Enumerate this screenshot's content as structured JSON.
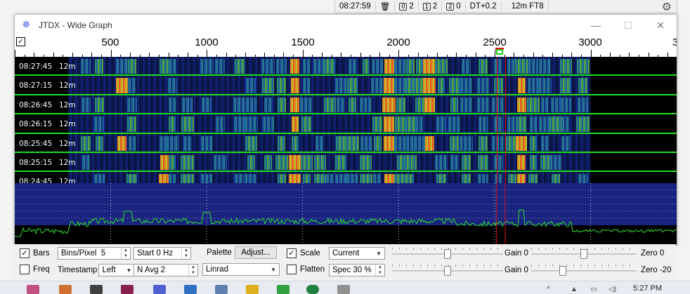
{
  "statusbar": {
    "time": "08:27:59",
    "trash_count": "",
    "q0_label": "0",
    "q0_value": "2",
    "q1_label": "1",
    "q1_value": "2",
    "q2_label": "2",
    "q2_value": "0",
    "dt": "DT+0.2",
    "band_mode": "12m FT8"
  },
  "window": {
    "title": "JTDX - Wide Graph",
    "minimize": "—",
    "maximize": "☐",
    "close": "✕"
  },
  "ruler": {
    "check": "✓",
    "labels": [
      "500",
      "1000",
      "1500",
      "2000",
      "2500",
      "3000"
    ],
    "edge_label": "3"
  },
  "waterfall": {
    "rows": [
      {
        "time": "08:27:45",
        "band": "12m"
      },
      {
        "time": "08:27:15",
        "band": "12m"
      },
      {
        "time": "08:26:45",
        "band": "12m"
      },
      {
        "time": "08:26:15",
        "band": "12m"
      },
      {
        "time": "08:25:45",
        "band": "12m"
      },
      {
        "time": "08:25:15",
        "band": "12m"
      },
      {
        "time": "08:24:45",
        "band": "12m"
      }
    ],
    "signal_columns_hz": [
      370,
      440,
      560,
      610,
      780,
      820,
      900,
      1000,
      1070,
      1170,
      1230,
      1320,
      1390,
      1460,
      1520,
      1590,
      1640,
      1700,
      1760,
      1830,
      1890,
      1950,
      2010,
      2060,
      2110,
      2160,
      2220,
      2290,
      2350,
      2440,
      2520,
      2590,
      2640,
      2700,
      2760,
      2820,
      2870,
      2960
    ],
    "hot_columns_hz": [
      560,
      780,
      1460,
      1950,
      2160,
      2640
    ],
    "tx_marker_hz": 2510,
    "rx_marker_hz": 2555
  },
  "controls": {
    "bars_label": "Bars",
    "bars_checked": "✓",
    "freq_label": "Freq",
    "bins_label": "Bins/Pixel",
    "bins_value": "5",
    "start_value": "Start 0 Hz",
    "timestamp_label": "Timestamp",
    "timestamp_value": "Left",
    "navg_value": "N Avg 2",
    "palette_button": "Palette",
    "adjust_button": "Adjust...",
    "palette_value": "Linrad",
    "scale_label": "Scale",
    "scale_checked": "✓",
    "flatten_label": "Flatten",
    "spectrum_mode": "Current",
    "spec_value": "Spec 30 %",
    "gain1_label": "Gain 0",
    "zero1_label": "Zero 0",
    "gain2_label": "Gain 0",
    "zero2_label": "Zero -20"
  },
  "taskbar": {
    "clock": "5:27 PM"
  },
  "colors": {
    "waterfall_bg": "#000000",
    "spectrum_bg": "#1a237e",
    "spectrum_trace": "#2ee02e",
    "row_line": "#1ee01e",
    "marker_red": "#e01010"
  }
}
